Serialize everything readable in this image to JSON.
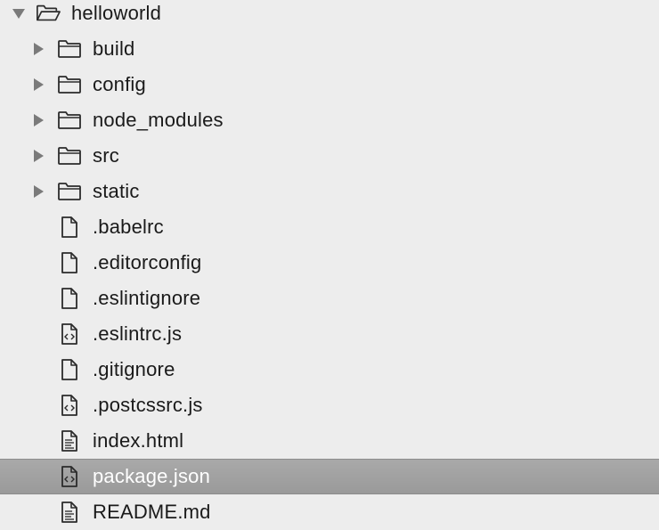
{
  "tree": {
    "root": {
      "label": "helloworld",
      "expanded": true,
      "icon": "folder-open-icon"
    },
    "items": [
      {
        "label": "build",
        "type": "folder",
        "icon": "folder-icon",
        "expanded": false
      },
      {
        "label": "config",
        "type": "folder",
        "icon": "folder-icon",
        "expanded": false
      },
      {
        "label": "node_modules",
        "type": "folder",
        "icon": "folder-icon",
        "expanded": false
      },
      {
        "label": "src",
        "type": "folder",
        "icon": "folder-icon",
        "expanded": false
      },
      {
        "label": "static",
        "type": "folder",
        "icon": "folder-icon",
        "expanded": false
      },
      {
        "label": ".babelrc",
        "type": "file",
        "icon": "file-icon"
      },
      {
        "label": ".editorconfig",
        "type": "file",
        "icon": "file-icon"
      },
      {
        "label": ".eslintignore",
        "type": "file",
        "icon": "file-icon"
      },
      {
        "label": ".eslintrc.js",
        "type": "file",
        "icon": "code-file-icon"
      },
      {
        "label": ".gitignore",
        "type": "file",
        "icon": "file-icon"
      },
      {
        "label": ".postcssrc.js",
        "type": "file",
        "icon": "code-file-icon"
      },
      {
        "label": "index.html",
        "type": "file",
        "icon": "text-file-icon"
      },
      {
        "label": "package.json",
        "type": "file",
        "icon": "code-file-icon",
        "selected": true
      },
      {
        "label": "README.md",
        "type": "file",
        "icon": "text-file-icon"
      }
    ]
  },
  "colors": {
    "background": "#ededed",
    "selection": "#a3a3a3",
    "text": "#1a1a1a",
    "selected_text": "#ffffff",
    "icon": "#2b2b2b",
    "twisty": "#7a7a7a"
  }
}
